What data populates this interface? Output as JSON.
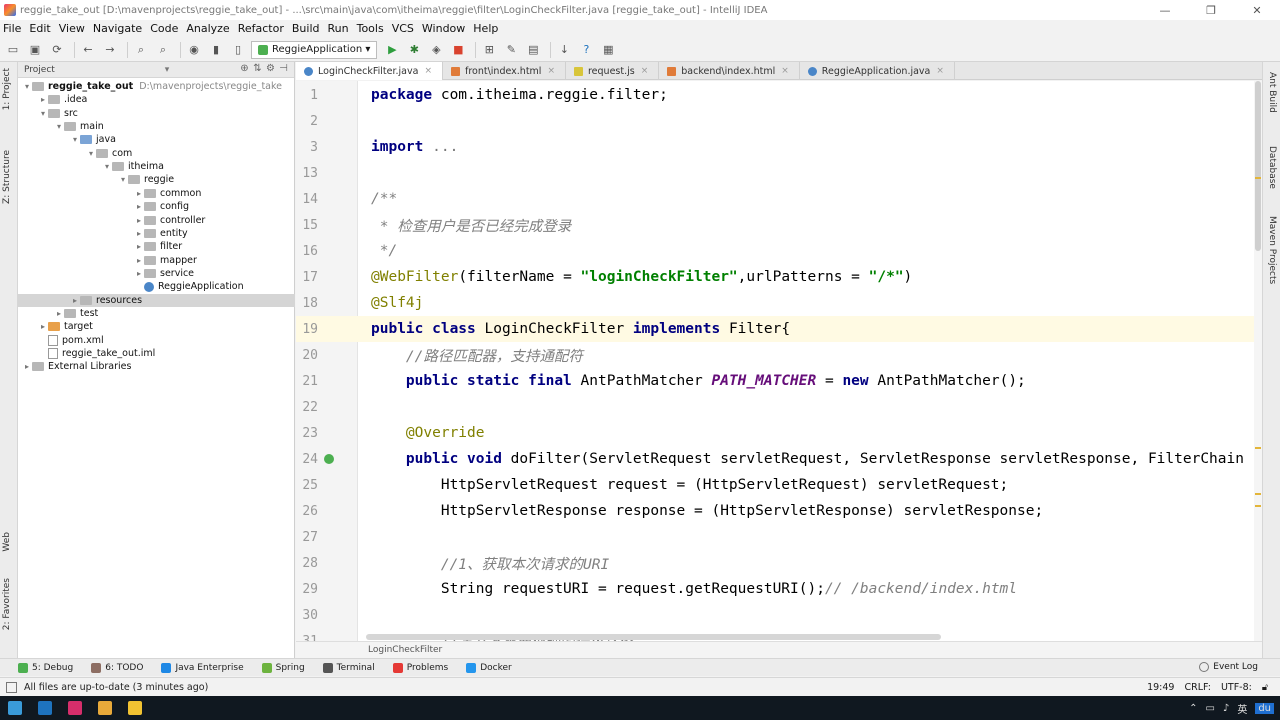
{
  "window": {
    "title": "reggie_take_out [D:\\mavenprojects\\reggie_take_out] - ...\\src\\main\\java\\com\\itheima\\reggie\\filter\\LoginCheckFilter.java [reggie_take_out] - IntelliJ IDEA",
    "controls": [
      "—",
      "❐",
      "✕"
    ]
  },
  "menu": [
    "File",
    "Edit",
    "View",
    "Navigate",
    "Code",
    "Analyze",
    "Refactor",
    "Build",
    "Run",
    "Tools",
    "VCS",
    "Window",
    "Help"
  ],
  "toolbar": {
    "run_config": "ReggieApplication ▾"
  },
  "left_strip": {
    "project_tab": "1: Project",
    "structure_tab": "Z: Structure",
    "web_tab": "Web",
    "favorites_tab": "2: Favorites"
  },
  "right_strip": {
    "ant_tab": "Ant Build",
    "database_tab": "Database",
    "maven_tab": "Maven Projects"
  },
  "project_panel": {
    "header": "Project",
    "tree": [
      {
        "label": "reggie_take_out",
        "sub": "D:\\mavenprojects\\reggie_take",
        "depth": 0,
        "icon": "folder-grey",
        "arrow": "▾",
        "bold": true
      },
      {
        "label": ".idea",
        "depth": 1,
        "icon": "folder-grey",
        "arrow": "▸"
      },
      {
        "label": "src",
        "depth": 1,
        "icon": "folder-grey",
        "arrow": "▾"
      },
      {
        "label": "main",
        "depth": 2,
        "icon": "folder-grey",
        "arrow": "▾"
      },
      {
        "label": "java",
        "depth": 3,
        "icon": "folder-blue",
        "arrow": "▾"
      },
      {
        "label": "com",
        "depth": 4,
        "icon": "folder-grey",
        "arrow": "▾"
      },
      {
        "label": "itheima",
        "depth": 5,
        "icon": "folder-grey",
        "arrow": "▾"
      },
      {
        "label": "reggie",
        "depth": 6,
        "icon": "folder-grey",
        "arrow": "▾"
      },
      {
        "label": "common",
        "depth": 7,
        "icon": "folder-grey",
        "arrow": "▸"
      },
      {
        "label": "config",
        "depth": 7,
        "icon": "folder-grey",
        "arrow": "▸"
      },
      {
        "label": "controller",
        "depth": 7,
        "icon": "folder-grey",
        "arrow": "▸"
      },
      {
        "label": "entity",
        "depth": 7,
        "icon": "folder-grey",
        "arrow": "▸"
      },
      {
        "label": "filter",
        "depth": 7,
        "icon": "folder-grey",
        "arrow": "▸"
      },
      {
        "label": "mapper",
        "depth": 7,
        "icon": "folder-grey",
        "arrow": "▸"
      },
      {
        "label": "service",
        "depth": 7,
        "icon": "folder-grey",
        "arrow": "▸"
      },
      {
        "label": "ReggieApplication",
        "depth": 7,
        "icon": "class",
        "arrow": ""
      },
      {
        "label": "resources",
        "depth": 3,
        "icon": "folder-grey",
        "arrow": "▸",
        "selected": true
      },
      {
        "label": "test",
        "depth": 2,
        "icon": "folder-grey",
        "arrow": "▸"
      },
      {
        "label": "target",
        "depth": 1,
        "icon": "folder-orange",
        "arrow": "▸"
      },
      {
        "label": "pom.xml",
        "depth": 1,
        "icon": "file",
        "arrow": ""
      },
      {
        "label": "reggie_take_out.iml",
        "depth": 1,
        "icon": "file",
        "arrow": ""
      },
      {
        "label": "External Libraries",
        "depth": 0,
        "icon": "folder-grey",
        "arrow": "▸"
      }
    ]
  },
  "editor_tabs": [
    {
      "label": "LoginCheckFilter.java",
      "type": "class",
      "active": true
    },
    {
      "label": "front\\index.html",
      "type": "html"
    },
    {
      "label": "request.js",
      "type": "js"
    },
    {
      "label": "backend\\index.html",
      "type": "html"
    },
    {
      "label": "ReggieApplication.java",
      "type": "class"
    }
  ],
  "editor": {
    "lines": [
      {
        "n": "1",
        "html": "<span class=\"kw\">package</span> com.itheima.reggie.filter;"
      },
      {
        "n": "2",
        "html": ""
      },
      {
        "n": "3",
        "html": "<span class=\"kw\">import</span> <span class=\"fold\">...</span>"
      },
      {
        "n": "13",
        "html": ""
      },
      {
        "n": "14",
        "html": "<span class=\"cmt\">/**</span>"
      },
      {
        "n": "15",
        "html": "<span class=\"cmt\"> * 检查用户是否已经完成登录</span>"
      },
      {
        "n": "16",
        "html": "<span class=\"cmt\"> */</span>"
      },
      {
        "n": "17",
        "html": "<span class=\"ann\">@WebFilter</span>(filterName = <span class=\"str\">\"loginCheckFilter\"</span>,urlPatterns = <span class=\"str\">\"/*\"</span>)"
      },
      {
        "n": "18",
        "html": "<span class=\"ann\">@Slf4j</span>"
      },
      {
        "n": "19",
        "html": "<span class=\"kw\">public class</span> LoginCheckFilter <span class=\"kw\">implements</span> Filter{",
        "current": true
      },
      {
        "n": "20",
        "html": "    <span class=\"cmt\">//路径匹配器，支持通配符</span>"
      },
      {
        "n": "21",
        "html": "    <span class=\"kw\">public static final</span> AntPathMatcher <span class=\"static\">PATH_MATCHER</span> = <span class=\"kw\">new</span> AntPathMatcher();"
      },
      {
        "n": "22",
        "html": ""
      },
      {
        "n": "23",
        "html": "    <span class=\"ann\">@Override</span>"
      },
      {
        "n": "24",
        "html": "    <span class=\"kw\">public void</span> doFilter(ServletRequest servletRequest, ServletResponse servletResponse, FilterChain f",
        "mark": true
      },
      {
        "n": "25",
        "html": "        HttpServletRequest request = (HttpServletRequest) servletRequest;"
      },
      {
        "n": "26",
        "html": "        HttpServletResponse response = (HttpServletResponse) servletResponse;"
      },
      {
        "n": "27",
        "html": ""
      },
      {
        "n": "28",
        "html": "        <span class=\"cmt\">//1、获取本次请求的URI</span>"
      },
      {
        "n": "29",
        "html": "        String requestURI = request.getRequestURI();<span class=\"cmt\">// /backend/index.html</span>"
      },
      {
        "n": "30",
        "html": ""
      },
      {
        "n": "31",
        "html": "        <span class=\"cmt\">//定义不需要处理的请求路径</span>"
      }
    ]
  },
  "breadcrumb": "LoginCheckFilter",
  "bottom_tabs": [
    {
      "label": "5: Debug",
      "color": "#4caf50"
    },
    {
      "label": "6: TODO",
      "color": "#8d6e63"
    },
    {
      "label": "Java Enterprise",
      "color": "#1e88e5"
    },
    {
      "label": "Spring",
      "color": "#6db33f"
    },
    {
      "label": "Terminal",
      "color": "#555555"
    },
    {
      "label": "Problems",
      "color": "#e53935"
    },
    {
      "label": "Docker",
      "color": "#2496ed"
    }
  ],
  "event_log": "Event Log",
  "status": {
    "message": "All files are up-to-date (3 minutes ago)",
    "position": "19:49",
    "line_sep": "CRLF:",
    "encoding": "UTF-8:"
  },
  "taskbar": {
    "items": [
      {
        "name": "start",
        "color": "#3a9bd9"
      },
      {
        "name": "app-1",
        "color": "#1e73be"
      },
      {
        "name": "intellij",
        "color": "#d62e6b"
      },
      {
        "name": "chrome",
        "color": "#e8a93a"
      },
      {
        "name": "explorer",
        "color": "#f1c232"
      }
    ],
    "tray_lang": "英",
    "tray_ime": "du"
  }
}
